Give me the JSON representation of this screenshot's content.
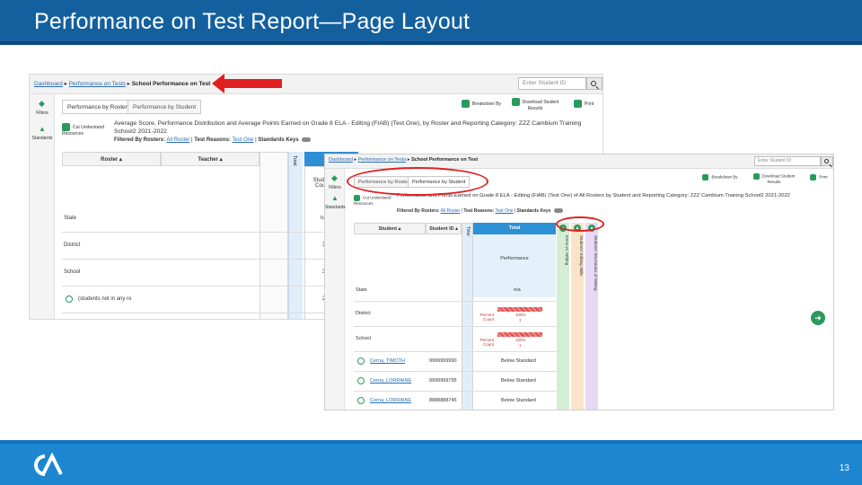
{
  "slide": {
    "title": "Performance on Test Report—Page Layout",
    "page_number": "13",
    "logo": "CA"
  },
  "colors": {
    "title_bar": "#14609f",
    "footer": "#1d86d0",
    "accent_green": "#2a9a5c",
    "total_blue": "#2d8fd4",
    "highlight_red": "#e02020"
  },
  "shot1": {
    "breadcrumb": {
      "item1": "Dashboard",
      "sep": "▸",
      "item2": "Performance on Tests",
      "current": "School Performance on Test"
    },
    "search_placeholder": "Enter Student ID",
    "rail": {
      "filters": "Filters",
      "standards": "Standards"
    },
    "tabs": {
      "by_roster": "Performance by Roster",
      "by_student": "Performance by Student"
    },
    "tools": {
      "breakdown": "Breakdown By",
      "download": "Download Student Results",
      "print": "Print"
    },
    "cut_link": "Cut Understand Resources",
    "description": "Average Score, Performance Distribution and Average Points Earned on Grade 8 ELA - Editing (FIAB) (Test One), by Roster and Reporting Category: ZZZ Cambium Training School2 2021-2022",
    "filters_line": {
      "filtered_label": "Filtered By Rosters:",
      "filtered_value": "All Roster",
      "reason_label": "Test Reasons:",
      "reason_value": "Test One",
      "keys_label": "Standards Keys"
    },
    "columns": {
      "roster": "Roster",
      "teacher": "Teacher",
      "student_count": "Student Count",
      "ca": "Ca",
      "vertical": "Total"
    },
    "rows": [
      {
        "name": "State",
        "count": "n/a"
      },
      {
        "name": "District",
        "count": "3"
      },
      {
        "name": "School",
        "count": "3"
      },
      {
        "name": "(students not in any ro",
        "count": "2"
      }
    ]
  },
  "shot2": {
    "breadcrumb": {
      "item1": "Dashboard",
      "sep": "▸",
      "item2": "Performance on Tests",
      "current": "School Performance on Test"
    },
    "search_placeholder": "Enter Student ID",
    "rail": {
      "filters": "Filters",
      "standards": "Standards"
    },
    "tabs": {
      "by_roster": "Performance by Roster",
      "by_student": "Performance by Student"
    },
    "tools": {
      "breakdown": "Breakdown By",
      "download": "Download Student Results",
      "print": "Print"
    },
    "cut_link": "Cut Understand Resources",
    "description": "Performance and Points Earned on Grade 8 ELA - Editing (FIAB) (Test One) of All Rosters by Student and Reporting Category: ZZZ Cambium Training School2 2021-2022",
    "filters_line": {
      "filtered_label": "Filtered By Rosters:",
      "filtered_value": "All Roster",
      "reason_label": "Test Reasons:",
      "reason_value": "Test One",
      "keys_label": "Standards Keys"
    },
    "columns": {
      "student": "Student",
      "student_id": "Student ID",
      "total": "Total",
      "performance": "Performance",
      "vertical": "Total"
    },
    "vertical_headers": [
      "Items vs. Writing",
      "Students' Editing Skills",
      "Students' Mechanics of Writing"
    ],
    "rows": [
      {
        "name": "State",
        "value": "n/a"
      },
      {
        "name": "District",
        "bar_label": "Percent Count",
        "bar_pct": "100%",
        "bar_count": "1"
      },
      {
        "name": "School",
        "bar_label": "Percent Count",
        "bar_pct": "100%",
        "bar_count": "1"
      },
      {
        "name": "Cerna, TIMOTH",
        "id": "9999999990",
        "performance": "Below Standard"
      },
      {
        "name": "Cerna, LORRAINE",
        "id": "9999999795",
        "performance": "Below Standard"
      },
      {
        "name": "Cerna, LORRAINE",
        "id": "8888888745",
        "performance": "Below Standard"
      }
    ]
  }
}
